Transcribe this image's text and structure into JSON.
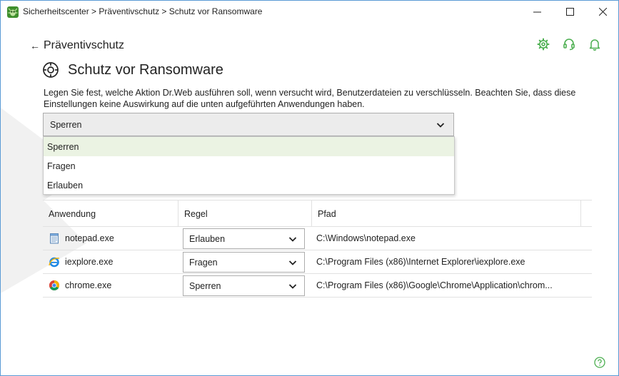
{
  "window": {
    "title": "Sicherheitscenter > Präventivschutz > Schutz vor Ransomware",
    "app_logo_icon": "drweb-spider-logo-icon"
  },
  "header": {
    "back_label": "Präventivschutz",
    "back_icon": "arrow-left-icon",
    "settings_icon": "gear-icon",
    "support_icon": "headset-icon",
    "notifications_icon": "bell-icon"
  },
  "page": {
    "title": "Schutz vor Ransomware",
    "icon": "ransomware-protection-icon",
    "description": "Legen Sie fest, welche Aktion Dr.Web ausführen soll, wenn versucht wird, Benutzerdateien zu verschlüsseln. Beachten Sie, dass diese Einstellungen keine Auswirkung auf die unten aufgeführten Anwendungen haben."
  },
  "action_select": {
    "value": "Sperren",
    "options": [
      "Sperren",
      "Fragen",
      "Erlauben"
    ],
    "highlighted": "Sperren"
  },
  "table": {
    "headers": {
      "app": "Anwendung",
      "rule": "Regel",
      "path": "Pfad"
    },
    "rows": [
      {
        "app": "notepad.exe",
        "icon": "notepad-icon",
        "rule": "Erlauben",
        "path": "C:\\Windows\\notepad.exe"
      },
      {
        "app": "iexplore.exe",
        "icon": "internet-explorer-icon",
        "rule": "Fragen",
        "path": "C:\\Program Files (x86)\\Internet Explorer\\iexplore.exe"
      },
      {
        "app": "chrome.exe",
        "icon": "chrome-icon",
        "rule": "Sperren",
        "path": "C:\\Program Files (x86)\\Google\\Chrome\\Application\\chrom..."
      }
    ]
  },
  "colors": {
    "accent_green": "#4caf50",
    "selection_bg": "#ebf3e3",
    "window_border": "#5a9bd5"
  }
}
